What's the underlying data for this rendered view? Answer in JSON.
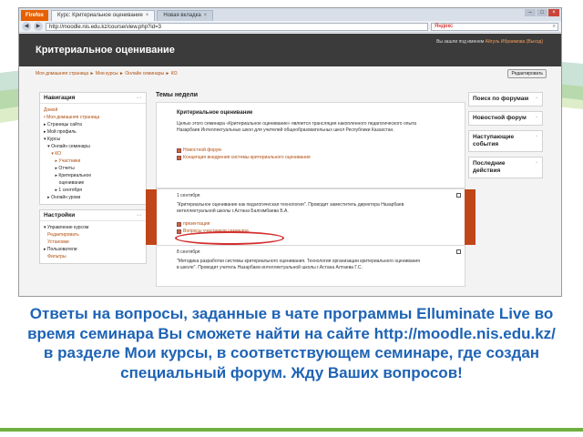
{
  "browser": {
    "app_button": "Firefox",
    "tabs": [
      {
        "label": "Курс: Критериальное оценивание",
        "active": true
      },
      {
        "label": "Новая вкладка",
        "active": false
      }
    ],
    "url": "http://moodle.nis.edu.kz/course/view.php?id=3",
    "search_engine": "Яндекс"
  },
  "moodle": {
    "site_title": "Критериальное оценивание",
    "login_prefix": "Вы зашли под именем ",
    "login_user": "Айгуль Ибраимова",
    "logout_link": "(Выход)",
    "breadcrumb": "Моя домашняя страница ► Мои курсы ► Онлайн семинары ► КО",
    "edit_button": "Редактировать",
    "nav_block": {
      "title": "Навигация",
      "items": [
        {
          "label": "Домой",
          "link": true
        },
        {
          "label": "• Моя домашняя страница",
          "link": true
        },
        {
          "label": "▸ Страницы сайта",
          "link": false
        },
        {
          "label": "▸ Мой профиль",
          "link": false
        },
        {
          "label": "▾ Курсы",
          "link": false
        },
        {
          "label": "   ▾ Онлайн семинары",
          "link": false
        },
        {
          "label": "      ▾ КО",
          "link": true
        },
        {
          "label": "         ▸ Участники",
          "link": true
        },
        {
          "label": "         ▸ Отчеты",
          "link": false
        },
        {
          "label": "         ▸ Критериальное",
          "link": false
        },
        {
          "label": "            оценивание",
          "link": false
        },
        {
          "label": "         ▸ 1 сентября",
          "link": false
        },
        {
          "label": "   ▸ Онлайн уроки",
          "link": false
        }
      ]
    },
    "settings_block": {
      "title": "Настройки",
      "items": [
        {
          "label": "▾ Управление курсом",
          "link": false
        },
        {
          "label": "   Редактировать",
          "link": true
        },
        {
          "label": "   Установки",
          "link": true
        },
        {
          "label": "▸ Пользователи",
          "link": false
        },
        {
          "label": "   Фильтры",
          "link": true
        }
      ]
    },
    "center_title": "Темы недели",
    "section0": {
      "heading": "Критериальное оценивание",
      "text": "Целью этого семинара «Критериальное оценивание» является трансляция накопленного педагогического опыта Назарбаев Интеллектуальных школ для учителей общеобразовательных школ Республики Казахстан.",
      "links": [
        "Новостной форум",
        "Концепция внедрения системы критериального оценивания"
      ]
    },
    "section1": {
      "date": "1 сентября",
      "text": "\"Критериальное оценивание как педагогическая технология\". Проводит заместитель директора Назарбаев интеллектуальной школы г.Астана Балгимбаева Б.А.",
      "links": [
        "презентация",
        "Вопросы участников семинара"
      ]
    },
    "section2": {
      "date": "8 сентября",
      "text": "\"Методика разработки системы критериального оценивания. Технология организации критериального оценивания в школе\". Проводит учитель Назарбаев интеллектуальной школы г.Астана Алтаева Г.С."
    },
    "right_blocks": [
      {
        "title": "Поиск по форумам"
      },
      {
        "title": "Новостной форум"
      },
      {
        "title": "Наступающие события"
      },
      {
        "title": "Последние действия"
      }
    ]
  },
  "caption": "Ответы на вопросы, заданные в чате программы Elluminate Live во время семинара Вы сможете найти на сайте http://moodle.nis.edu.kz/ в разделе Мои курсы, в соответствующем семинаре, где создан специальный форум. Жду Ваших вопросов!",
  "colors": {
    "caption": "#1e63b5",
    "moodle_header": "#3b3b3b",
    "highlight_band": "#c0461a",
    "annotation_oval": "#d32f2f",
    "slide_accent": "#6fae3f"
  }
}
